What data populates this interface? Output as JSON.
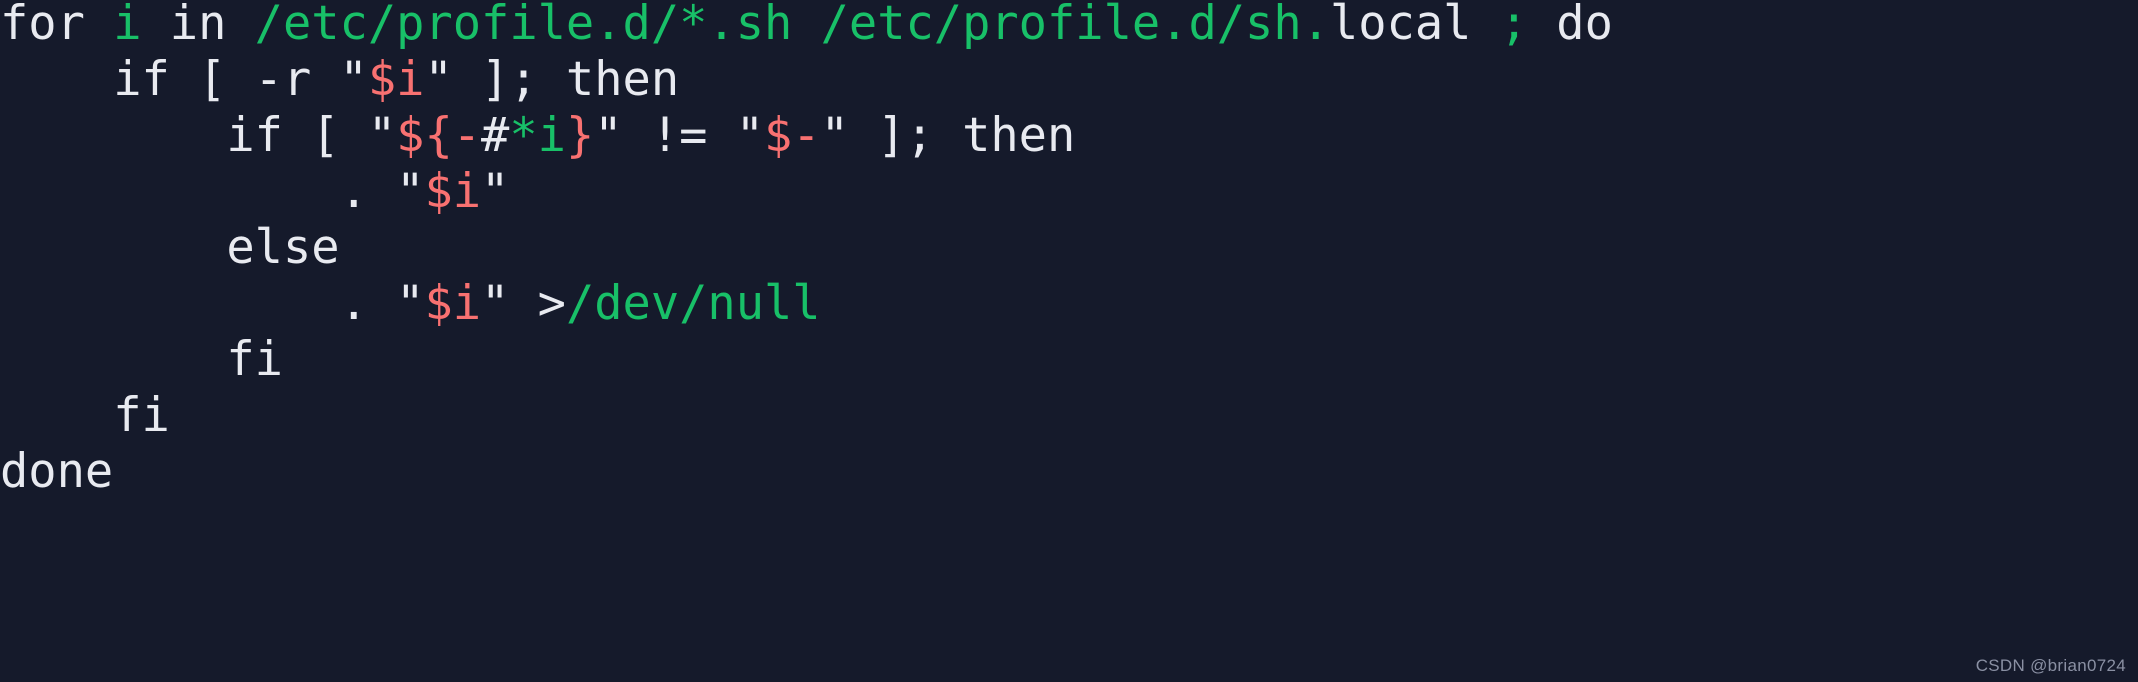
{
  "theme": {
    "background": "#151a2b",
    "foreground": "#e8eaf0",
    "green": "#18c068",
    "red": "#f87171"
  },
  "code": {
    "language": "bash",
    "plain_text": "for i in /etc/profile.d/*.sh /etc/profile.d/sh.local ; do\n    if [ -r \"$i\" ]; then\n        if [ \"${-#*i}\" != \"$-\" ]; then\n            . \"$i\"\n        else\n            . \"$i\" >/dev/null\n        fi\n    fi\ndone",
    "lines": [
      {
        "indent": "",
        "tokens": [
          {
            "text": "for ",
            "kind": "plain"
          },
          {
            "text": "i",
            "kind": "string"
          },
          {
            "text": " in ",
            "kind": "plain"
          },
          {
            "text": "/etc/profile.d/*.sh /etc/profile.d/sh.",
            "kind": "string"
          },
          {
            "text": "local ",
            "kind": "plain"
          },
          {
            "text": ";",
            "kind": "string"
          },
          {
            "text": " do",
            "kind": "plain"
          }
        ]
      },
      {
        "indent": "    ",
        "tokens": [
          {
            "text": "if [ -r \"",
            "kind": "plain"
          },
          {
            "text": "$i",
            "kind": "red"
          },
          {
            "text": "\" ]; then",
            "kind": "plain"
          }
        ]
      },
      {
        "indent": "        ",
        "tokens": [
          {
            "text": "if [ \"",
            "kind": "plain"
          },
          {
            "text": "${-",
            "kind": "red"
          },
          {
            "text": "#",
            "kind": "plain"
          },
          {
            "text": "*i",
            "kind": "string"
          },
          {
            "text": "}",
            "kind": "red"
          },
          {
            "text": "\" != \"",
            "kind": "plain"
          },
          {
            "text": "$-",
            "kind": "red"
          },
          {
            "text": "\" ]; then",
            "kind": "plain"
          }
        ]
      },
      {
        "indent": "            ",
        "tokens": [
          {
            "text": ". \"",
            "kind": "plain"
          },
          {
            "text": "$i",
            "kind": "red"
          },
          {
            "text": "\"",
            "kind": "plain"
          }
        ]
      },
      {
        "indent": "        ",
        "tokens": [
          {
            "text": "else",
            "kind": "plain"
          }
        ]
      },
      {
        "indent": "            ",
        "tokens": [
          {
            "text": ". \"",
            "kind": "plain"
          },
          {
            "text": "$i",
            "kind": "red"
          },
          {
            "text": "\" >",
            "kind": "plain"
          },
          {
            "text": "/dev/null",
            "kind": "string"
          }
        ]
      },
      {
        "indent": "        ",
        "tokens": [
          {
            "text": "fi",
            "kind": "plain"
          }
        ]
      },
      {
        "indent": "    ",
        "tokens": [
          {
            "text": "fi",
            "kind": "plain"
          }
        ]
      },
      {
        "indent": "",
        "tokens": [
          {
            "text": "done",
            "kind": "plain"
          }
        ]
      }
    ]
  },
  "watermark": {
    "text": "CSDN @brian0724"
  }
}
